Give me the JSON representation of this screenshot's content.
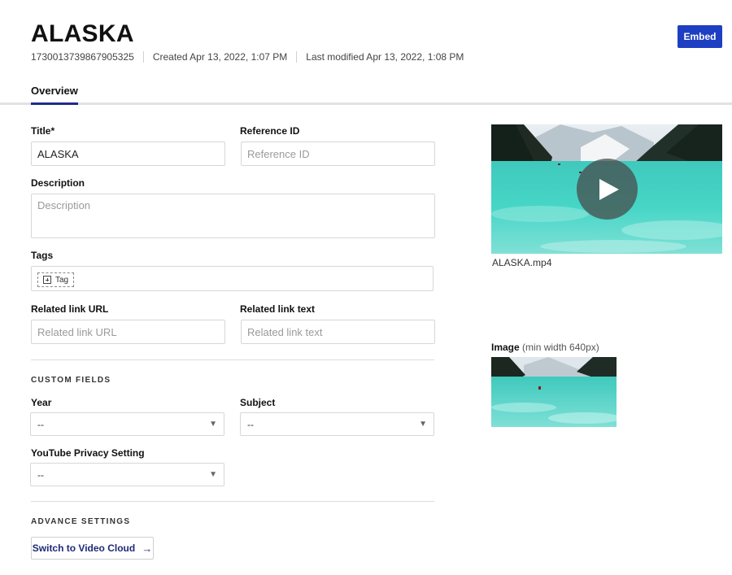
{
  "header": {
    "title": "ALASKA",
    "video_id": "1730013739867905325",
    "created": "Created Apr 13, 2022, 1:07 PM",
    "modified": "Last modified Apr 13, 2022, 1:08 PM",
    "embed_label": "Embed"
  },
  "tabs": [
    {
      "label": "Overview",
      "active": true
    }
  ],
  "form": {
    "title_label": "Title*",
    "title_value": "ALASKA",
    "reference_id_label": "Reference ID",
    "reference_id_placeholder": "Reference ID",
    "description_label": "Description",
    "description_placeholder": "Description",
    "tags_label": "Tags",
    "tag_button_label": "Tag",
    "related_url_label": "Related link URL",
    "related_url_placeholder": "Related link URL",
    "related_text_label": "Related link text",
    "related_text_placeholder": "Related link text"
  },
  "custom_fields": {
    "heading": "CUSTOM FIELDS",
    "year_label": "Year",
    "year_value": "--",
    "subject_label": "Subject",
    "subject_value": "--",
    "youtube_label": "YouTube Privacy Setting",
    "youtube_value": "--"
  },
  "advance": {
    "heading": "ADVANCE SETTINGS",
    "switch_label": "Switch to Video Cloud"
  },
  "media": {
    "video_filename": "ALASKA.mp4",
    "image_label": "Image",
    "image_hint": "(min width 640px)"
  },
  "colors": {
    "accent": "#1e3fc2",
    "tab_underline": "#1f2a8c",
    "lake": "#3ecfc0"
  }
}
